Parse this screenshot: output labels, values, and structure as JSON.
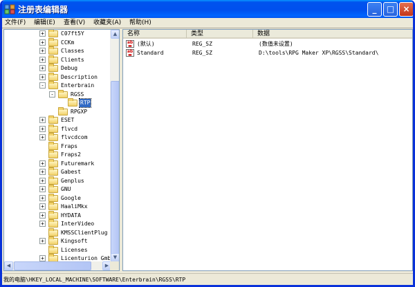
{
  "window": {
    "title": "注册表编辑器"
  },
  "title_buttons": {
    "minimize": "_",
    "maximize": "□",
    "close": "×"
  },
  "menu": [
    "文件(F)",
    "编辑(E)",
    "查看(V)",
    "收藏夹(A)",
    "帮助(H)"
  ],
  "tree": [
    {
      "label": "C07ft5Y",
      "depth": 0,
      "expander": "+"
    },
    {
      "label": "CCKm",
      "depth": 0,
      "expander": "+"
    },
    {
      "label": "Classes",
      "depth": 0,
      "expander": "+"
    },
    {
      "label": "Clients",
      "depth": 0,
      "expander": "+"
    },
    {
      "label": "Debug",
      "depth": 0,
      "expander": "+"
    },
    {
      "label": "Description",
      "depth": 0,
      "expander": "+"
    },
    {
      "label": "Enterbrain",
      "depth": 0,
      "expander": "-"
    },
    {
      "label": "RGSS",
      "depth": 1,
      "expander": "-"
    },
    {
      "label": "RTP",
      "depth": 2,
      "expander": "",
      "selected": true
    },
    {
      "label": "RPGXP",
      "depth": 1,
      "expander": ""
    },
    {
      "label": "ESET",
      "depth": 0,
      "expander": "+"
    },
    {
      "label": "flvcd",
      "depth": 0,
      "expander": "+"
    },
    {
      "label": "flvcdcom",
      "depth": 0,
      "expander": "+"
    },
    {
      "label": "Fraps",
      "depth": 0,
      "expander": ""
    },
    {
      "label": "Fraps2",
      "depth": 0,
      "expander": ""
    },
    {
      "label": "Futuremark",
      "depth": 0,
      "expander": "+"
    },
    {
      "label": "Gabest",
      "depth": 0,
      "expander": "+"
    },
    {
      "label": "Genplus",
      "depth": 0,
      "expander": "+"
    },
    {
      "label": "GNU",
      "depth": 0,
      "expander": "+"
    },
    {
      "label": "Google",
      "depth": 0,
      "expander": "+"
    },
    {
      "label": "HaaliMkx",
      "depth": 0,
      "expander": "+"
    },
    {
      "label": "HYDATA",
      "depth": 0,
      "expander": "+"
    },
    {
      "label": "InterVideo",
      "depth": 0,
      "expander": "+"
    },
    {
      "label": "KMSSClientPlug",
      "depth": 0,
      "expander": ""
    },
    {
      "label": "Kingsoft",
      "depth": 0,
      "expander": "+"
    },
    {
      "label": "Licenses",
      "depth": 0,
      "expander": ""
    },
    {
      "label": "Licenturion GmbH",
      "depth": 0,
      "expander": "+"
    }
  ],
  "list": {
    "columns": [
      "名称",
      "类型",
      "数据"
    ],
    "rows": [
      {
        "name": "(默认)",
        "type": "REG_SZ",
        "data": "(数值未设置)",
        "icon": "string-value-icon"
      },
      {
        "name": "Standard",
        "type": "REG_SZ",
        "data": "D:\\tools\\RPG Maker XP\\RGSS\\Standard\\",
        "icon": "string-value-icon"
      }
    ]
  },
  "status": {
    "path": "我的电脑\\HKEY_LOCAL_MACHINE\\SOFTWARE\\Enterbrain\\RGSS\\RTP"
  },
  "colors": {
    "titlebar": "#0053ee",
    "selection": "#316ac5",
    "chrome": "#ece9d8"
  }
}
